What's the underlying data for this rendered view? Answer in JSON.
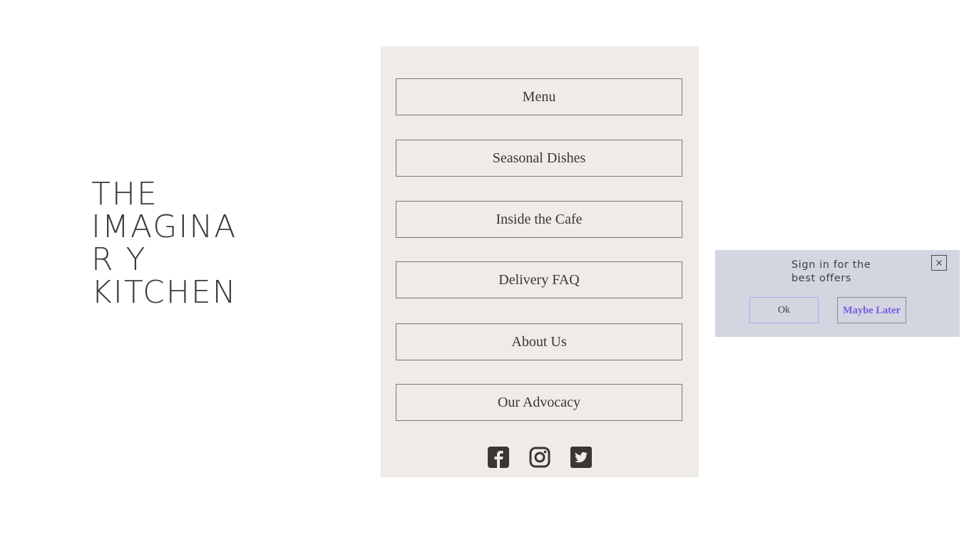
{
  "logo": {
    "lines": [
      "THE",
      "IMAGINA",
      "R Y",
      "KITCHEN"
    ],
    "alt": "The Imaginary Kitchen"
  },
  "nav": {
    "items": [
      {
        "label": "Menu"
      },
      {
        "label": "Seasonal Dishes"
      },
      {
        "label": "Inside the Cafe"
      },
      {
        "label": "Delivery FAQ"
      },
      {
        "label": "About Us"
      },
      {
        "label": "Our Advocacy"
      }
    ]
  },
  "socials": [
    {
      "name": "facebook-icon"
    },
    {
      "name": "instagram-icon"
    },
    {
      "name": "twitter-icon"
    }
  ],
  "popup": {
    "title": "Sign in for the best offers",
    "ok_label": "Ok",
    "later_label": "Maybe Later",
    "close_icon": "close-icon"
  },
  "colors": {
    "panel_bg": "#efebe6",
    "popup_bg": "#d3d6e0",
    "accent": "#7a5ae6",
    "icon": "#3a3631"
  }
}
